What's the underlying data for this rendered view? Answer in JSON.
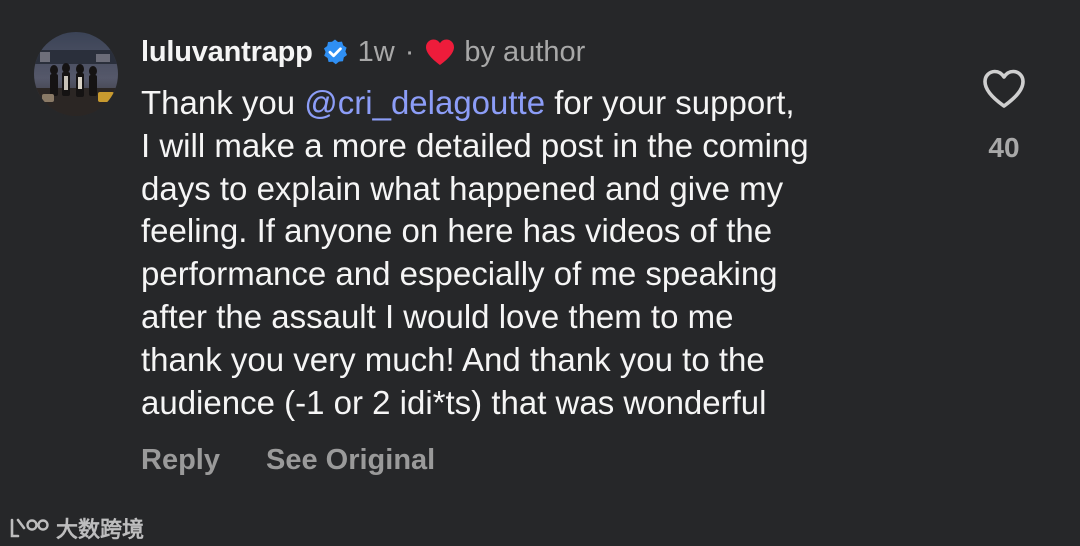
{
  "comment": {
    "username": "luluvantrapp",
    "time": "1w",
    "separator": "·",
    "liked_by_author_label": "by author",
    "mention": "@cri_delagoutte",
    "first_line_prefix": "Thank you ",
    "first_line_suffix": " for your support,",
    "body_lines": [
      "I will make a more detailed post in the coming",
      "days to explain what happened and give my",
      "feeling. If anyone on here has videos of the",
      "performance and especially of me speaking",
      "after the assault I would love them to me",
      "thank you very much! And thank you to the",
      "audience (-1 or 2 idi*ts) that was wonderful"
    ],
    "like_count": "40",
    "reply_label": "Reply",
    "see_original_label": "See Original"
  },
  "icons": {
    "verified": "verified-badge-icon",
    "author_heart": "heart-filled-icon",
    "like": "heart-outline-icon"
  },
  "colors": {
    "background": "#262729",
    "mention": "#8c9df7",
    "verified": "#2f8ff3",
    "heart": "#ee1c3b",
    "muted_text": "#a8a8a8"
  },
  "watermark": {
    "text": "大数跨境"
  }
}
